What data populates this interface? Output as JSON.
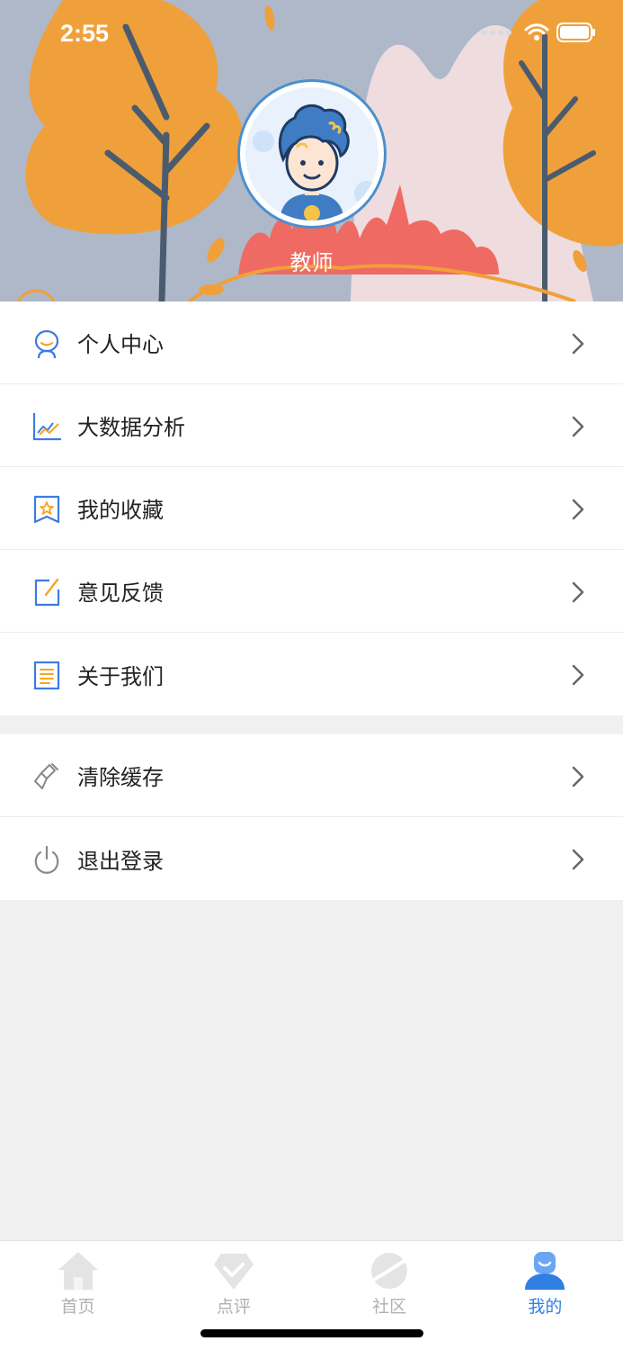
{
  "status_bar": {
    "time": "2:55"
  },
  "profile": {
    "name": "教师"
  },
  "menu_group1": [
    {
      "label": "个人中心",
      "icon": "person-icon"
    },
    {
      "label": "大数据分析",
      "icon": "chart-icon"
    },
    {
      "label": "我的收藏",
      "icon": "bookmark-star-icon"
    },
    {
      "label": "意见反馈",
      "icon": "edit-note-icon"
    },
    {
      "label": "关于我们",
      "icon": "document-icon"
    }
  ],
  "menu_group2": [
    {
      "label": "清除缓存",
      "icon": "brush-icon"
    },
    {
      "label": "退出登录",
      "icon": "power-icon"
    }
  ],
  "tabs": [
    {
      "label": "首页",
      "icon": "home-icon",
      "active": false
    },
    {
      "label": "点评",
      "icon": "diamond-check-icon",
      "active": false
    },
    {
      "label": "社区",
      "icon": "planet-icon",
      "active": false
    },
    {
      "label": "我的",
      "icon": "user-icon",
      "active": true
    }
  ],
  "colors": {
    "accent": "#2f7fe3",
    "header_bg": "#aeb8c8",
    "tree_orange": "#f0a03a"
  }
}
